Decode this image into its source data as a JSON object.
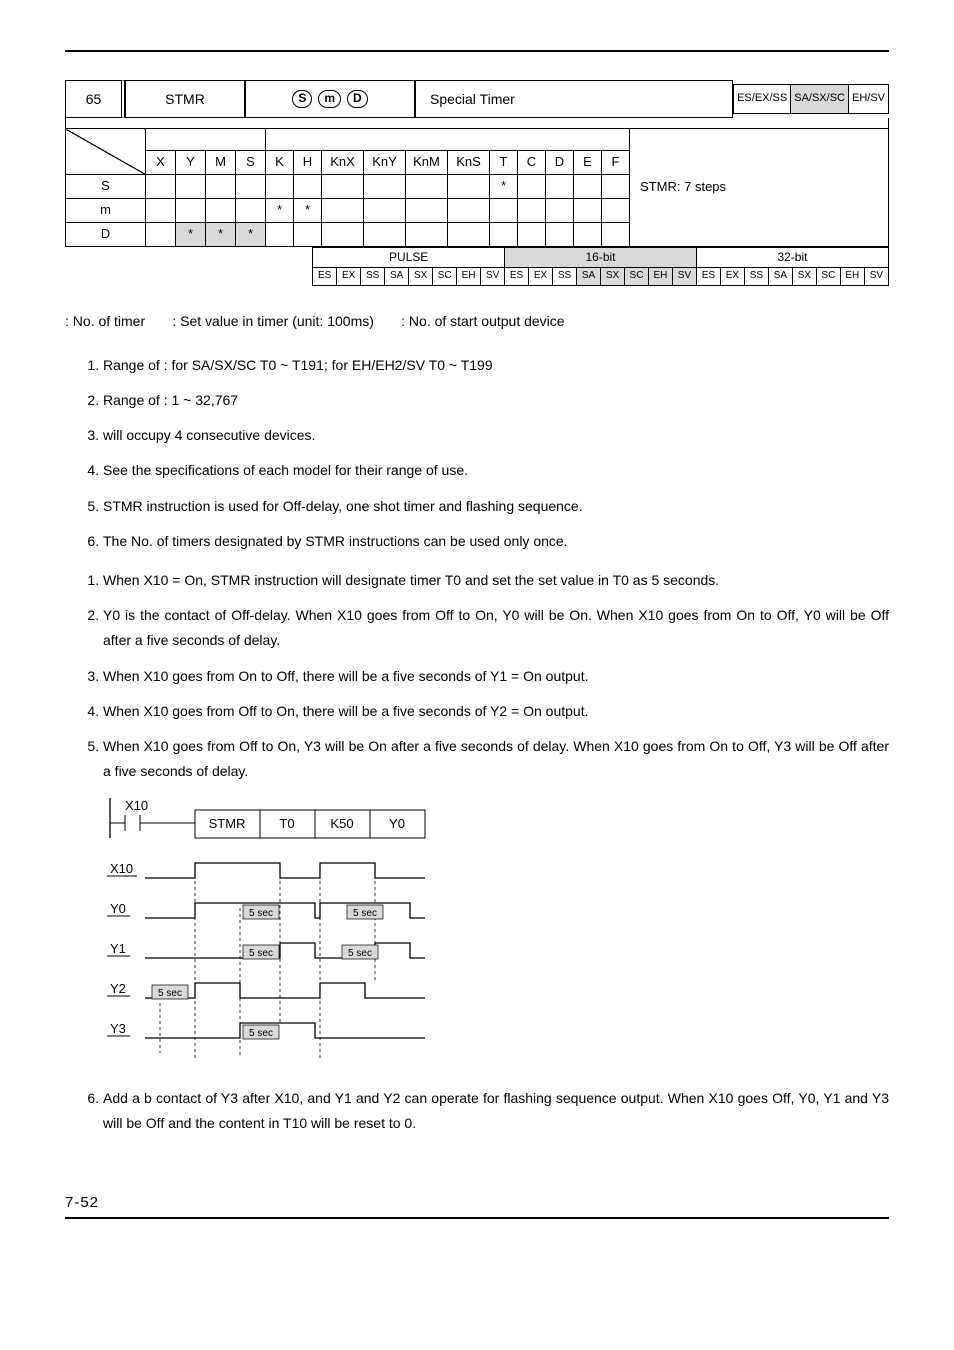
{
  "api": {
    "number": "65",
    "mnemonic": "STMR",
    "operands_glyphs": [
      "S",
      "m",
      "D"
    ],
    "function": "Special Timer",
    "controllers": [
      "ES/EX/SS",
      "SA/SX/SC",
      "EH/SV"
    ]
  },
  "device_table": {
    "bit_header": [
      "X",
      "Y",
      "M",
      "S"
    ],
    "word_header": [
      "K",
      "H",
      "KnX",
      "KnY",
      "KnM",
      "KnS",
      "T",
      "C",
      "D",
      "E",
      "F"
    ],
    "program_steps": "STMR: 7 steps",
    "rows": [
      {
        "label": "S",
        "cells": [
          "",
          "",
          "",
          "",
          "",
          "",
          "",
          "",
          "",
          "",
          "*",
          "",
          "",
          "",
          ""
        ]
      },
      {
        "label": "m",
        "cells": [
          "",
          "",
          "",
          "",
          "*",
          "*",
          "",
          "",
          "",
          "",
          "",
          "",
          "",
          "",
          ""
        ]
      },
      {
        "label": "D",
        "cells": [
          "",
          "*",
          "*",
          "*",
          "",
          "",
          "",
          "",
          "",
          "",
          "",
          "",
          "",
          "",
          ""
        ]
      }
    ]
  },
  "foot": {
    "groups": [
      "PULSE",
      "16-bit",
      "32-bit"
    ],
    "cells": [
      "ES",
      "EX",
      "SS",
      "SA",
      "SX",
      "SC",
      "EH",
      "SV",
      "ES",
      "EX",
      "SS",
      "SA",
      "SX",
      "SC",
      "EH",
      "SV",
      "ES",
      "EX",
      "SS",
      "SA",
      "SX",
      "SC",
      "EH",
      "SV"
    ]
  },
  "operands_line": {
    "c1": ": No. of timer",
    "c2": ": Set value in timer (unit: 100ms)",
    "c3": ": No. of start output device"
  },
  "explanations": [
    "Range of   : for SA/SX/SC T0 ~ T191; for EH/EH2/SV T0 ~ T199",
    "Range of   : 1 ~ 32,767",
    "  will occupy 4 consecutive devices.",
    "See the specifications of each model for their range of use.",
    "STMR instruction is used for Off-delay, one shot timer and flashing sequence.",
    "The No. of timers designated by STMR instructions can be used only once."
  ],
  "examples_a": [
    "When X10 = On, STMR instruction will designate timer T0 and set the set value in T0 as 5 seconds.",
    "Y0 is the contact of Off-delay. When X10 goes from Off to On, Y0 will be On. When X10 goes from On to Off, Y0 will be Off after a five seconds of delay.",
    "When X10 goes from On to Off, there will be a five seconds of Y1 = On output.",
    "When X10 goes from Off to On, there will be a five seconds of Y2 = On output.",
    "When X10 goes from Off to On, Y3 will be On after a five seconds of delay. When X10 goes from On to Off, Y3 will be Off after a five seconds of delay."
  ],
  "examples_b": [
    "Add a b contact of Y3 after X10, and Y1 and Y2 can operate for flashing sequence output. When X10 goes Off, Y0, Y1 and Y3 will be Off and the content in T10 will be reset to 0."
  ],
  "ladder": {
    "contact": "X10",
    "instr": "STMR",
    "p1": "T0",
    "p2": "K50",
    "p3": "Y0"
  },
  "timing": {
    "rows": [
      "X10",
      "Y0",
      "Y1",
      "Y2",
      "Y3"
    ],
    "label5sec": "5 sec"
  },
  "page_number": "7-52"
}
